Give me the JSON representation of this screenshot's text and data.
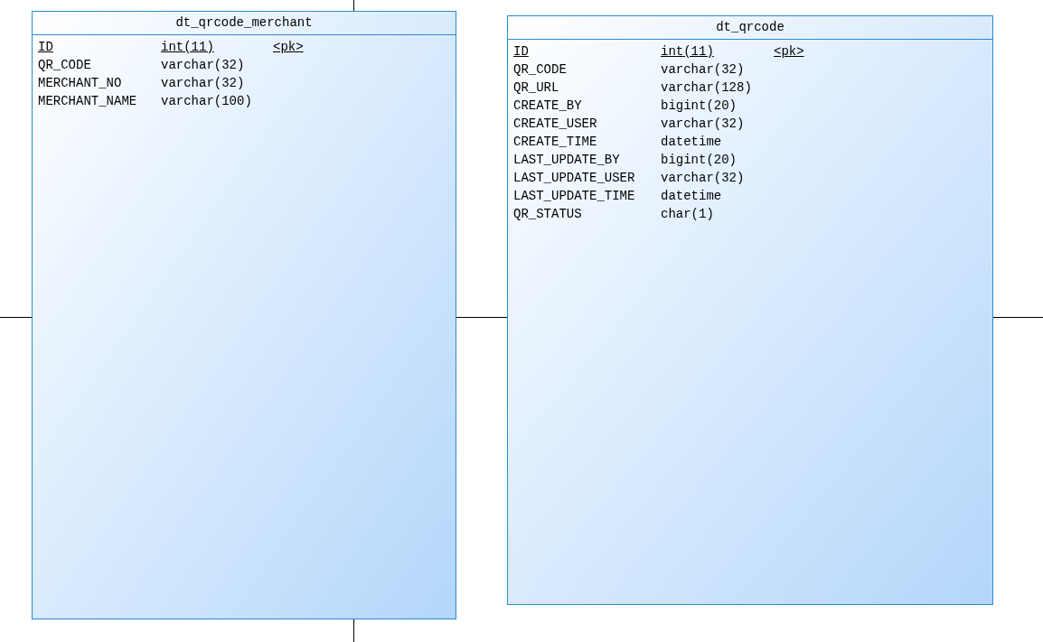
{
  "tables": [
    {
      "name": "dt_qrcode_merchant",
      "columns": [
        {
          "name": "ID",
          "type": "int(11)",
          "key": "<pk>",
          "primary_key": true
        },
        {
          "name": "QR_CODE",
          "type": "varchar(32)",
          "primary_key": false
        },
        {
          "name": "MERCHANT_NO",
          "type": "varchar(32)",
          "primary_key": false
        },
        {
          "name": "MERCHANT_NAME",
          "type": "varchar(100)",
          "primary_key": false
        }
      ]
    },
    {
      "name": "dt_qrcode",
      "columns": [
        {
          "name": "ID",
          "type": "int(11)",
          "key": "<pk>",
          "primary_key": true
        },
        {
          "name": "QR_CODE",
          "type": "varchar(32)",
          "primary_key": false
        },
        {
          "name": "QR_URL",
          "type": "varchar(128)",
          "primary_key": false
        },
        {
          "name": "CREATE_BY",
          "type": "bigint(20)",
          "primary_key": false
        },
        {
          "name": "CREATE_USER",
          "type": "varchar(32)",
          "primary_key": false
        },
        {
          "name": "CREATE_TIME",
          "type": "datetime",
          "primary_key": false
        },
        {
          "name": "LAST_UPDATE_BY",
          "type": "bigint(20)",
          "primary_key": false
        },
        {
          "name": "LAST_UPDATE_USER",
          "type": "varchar(32)",
          "primary_key": false
        },
        {
          "name": "LAST_UPDATE_TIME",
          "type": "datetime",
          "primary_key": false
        },
        {
          "name": "QR_STATUS",
          "type": "char(1)",
          "primary_key": false
        }
      ]
    }
  ]
}
